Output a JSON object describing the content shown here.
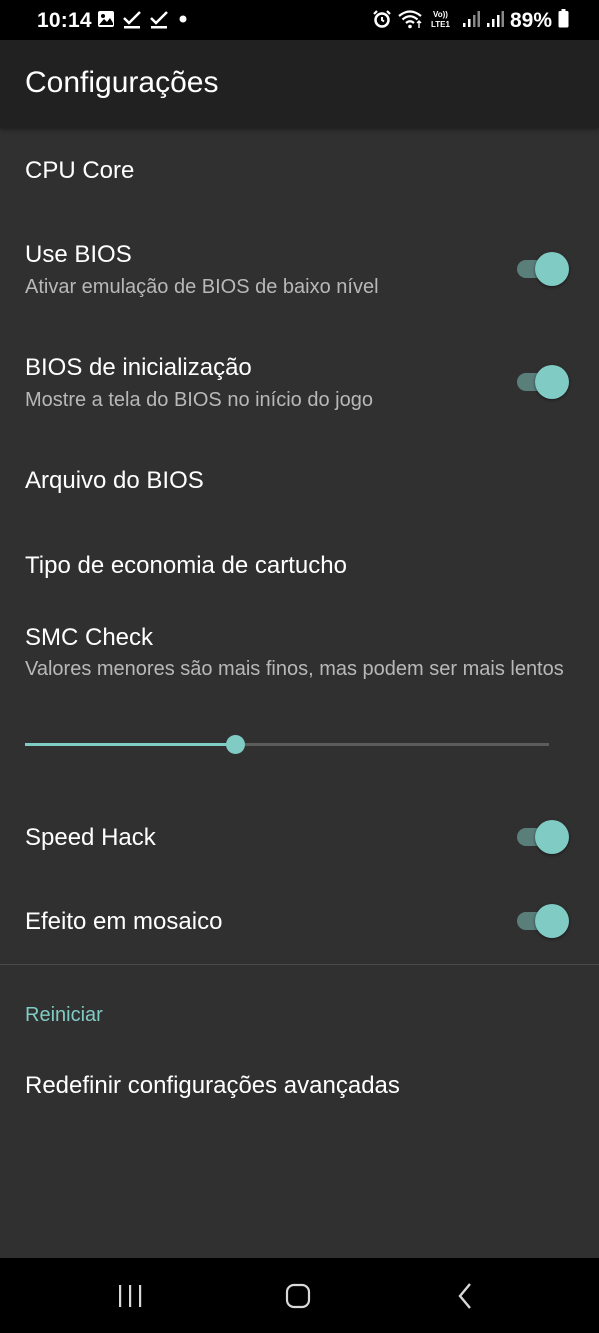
{
  "status_bar": {
    "time": "10:14",
    "battery_percent": "89%",
    "left_icons": [
      "image-icon",
      "check-icon",
      "check-icon",
      "dot-icon"
    ],
    "right_icons": [
      "alarm-icon",
      "wifi-icon",
      "volte-lte-icon",
      "signal-icon",
      "signal-icon",
      "battery-icon"
    ]
  },
  "app_bar": {
    "title": "Configurações"
  },
  "preferences": {
    "cpu_core": {
      "title": "CPU Core"
    },
    "use_bios": {
      "title": "Use BIOS",
      "summary": "Ativar emulação de BIOS de baixo nível",
      "checked": true
    },
    "boot_bios": {
      "title": "BIOS de inicialização",
      "summary": "Mostre a tela do BIOS no início do jogo",
      "checked": true
    },
    "bios_file": {
      "title": "Arquivo do BIOS"
    },
    "save_type": {
      "title": "Tipo de economia de cartucho"
    },
    "smc_check": {
      "title": "SMC Check",
      "summary": "Valores menores são mais finos, mas podem ser mais lentos",
      "slider_fraction": 0.4
    },
    "speed_hack": {
      "title": "Speed Hack",
      "checked": true
    },
    "mosaic": {
      "title": "Efeito em mosaico",
      "checked": true
    }
  },
  "reset_category": {
    "title": "Reiniciar",
    "reset_advanced": {
      "title": "Redefinir configurações avançadas"
    }
  },
  "nav_bar": {
    "recents": "recents-icon",
    "home": "home-icon",
    "back": "back-icon"
  },
  "colors": {
    "accent": "#80cbc4",
    "background": "#303030",
    "app_bar": "#212121"
  }
}
